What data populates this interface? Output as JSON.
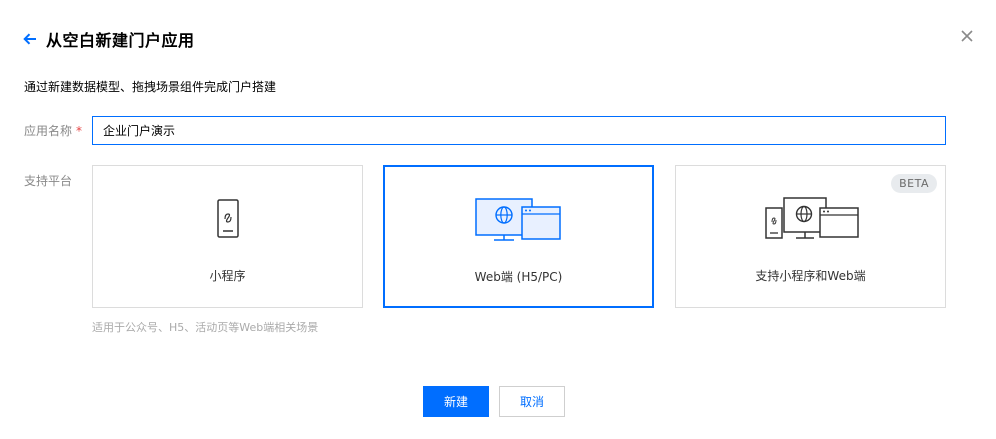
{
  "header": {
    "title": "从空白新建门户应用",
    "back_icon": "arrow-left-icon",
    "close_icon": "close-icon"
  },
  "description": "通过新建数据模型、拖拽场景组件完成门户搭建",
  "form": {
    "name_label": "应用名称",
    "required_mark": "*",
    "name_value": "企业门户演示",
    "platform_label": "支持平台"
  },
  "platforms": [
    {
      "label": "小程序",
      "icon": "mini-program-phone-icon",
      "selected": false
    },
    {
      "label": "Web端 (H5/PC)",
      "icon": "web-monitor-icon",
      "selected": true
    },
    {
      "label": "支持小程序和Web端",
      "icon": "multi-device-icon",
      "selected": false,
      "badge": "BETA"
    }
  ],
  "hint": "适用于公众号、H5、活动页等Web端相关场景",
  "buttons": {
    "create": "新建",
    "cancel": "取消"
  },
  "colors": {
    "accent": "#006eff",
    "required": "#e54545",
    "icon_dark": "#333333"
  }
}
